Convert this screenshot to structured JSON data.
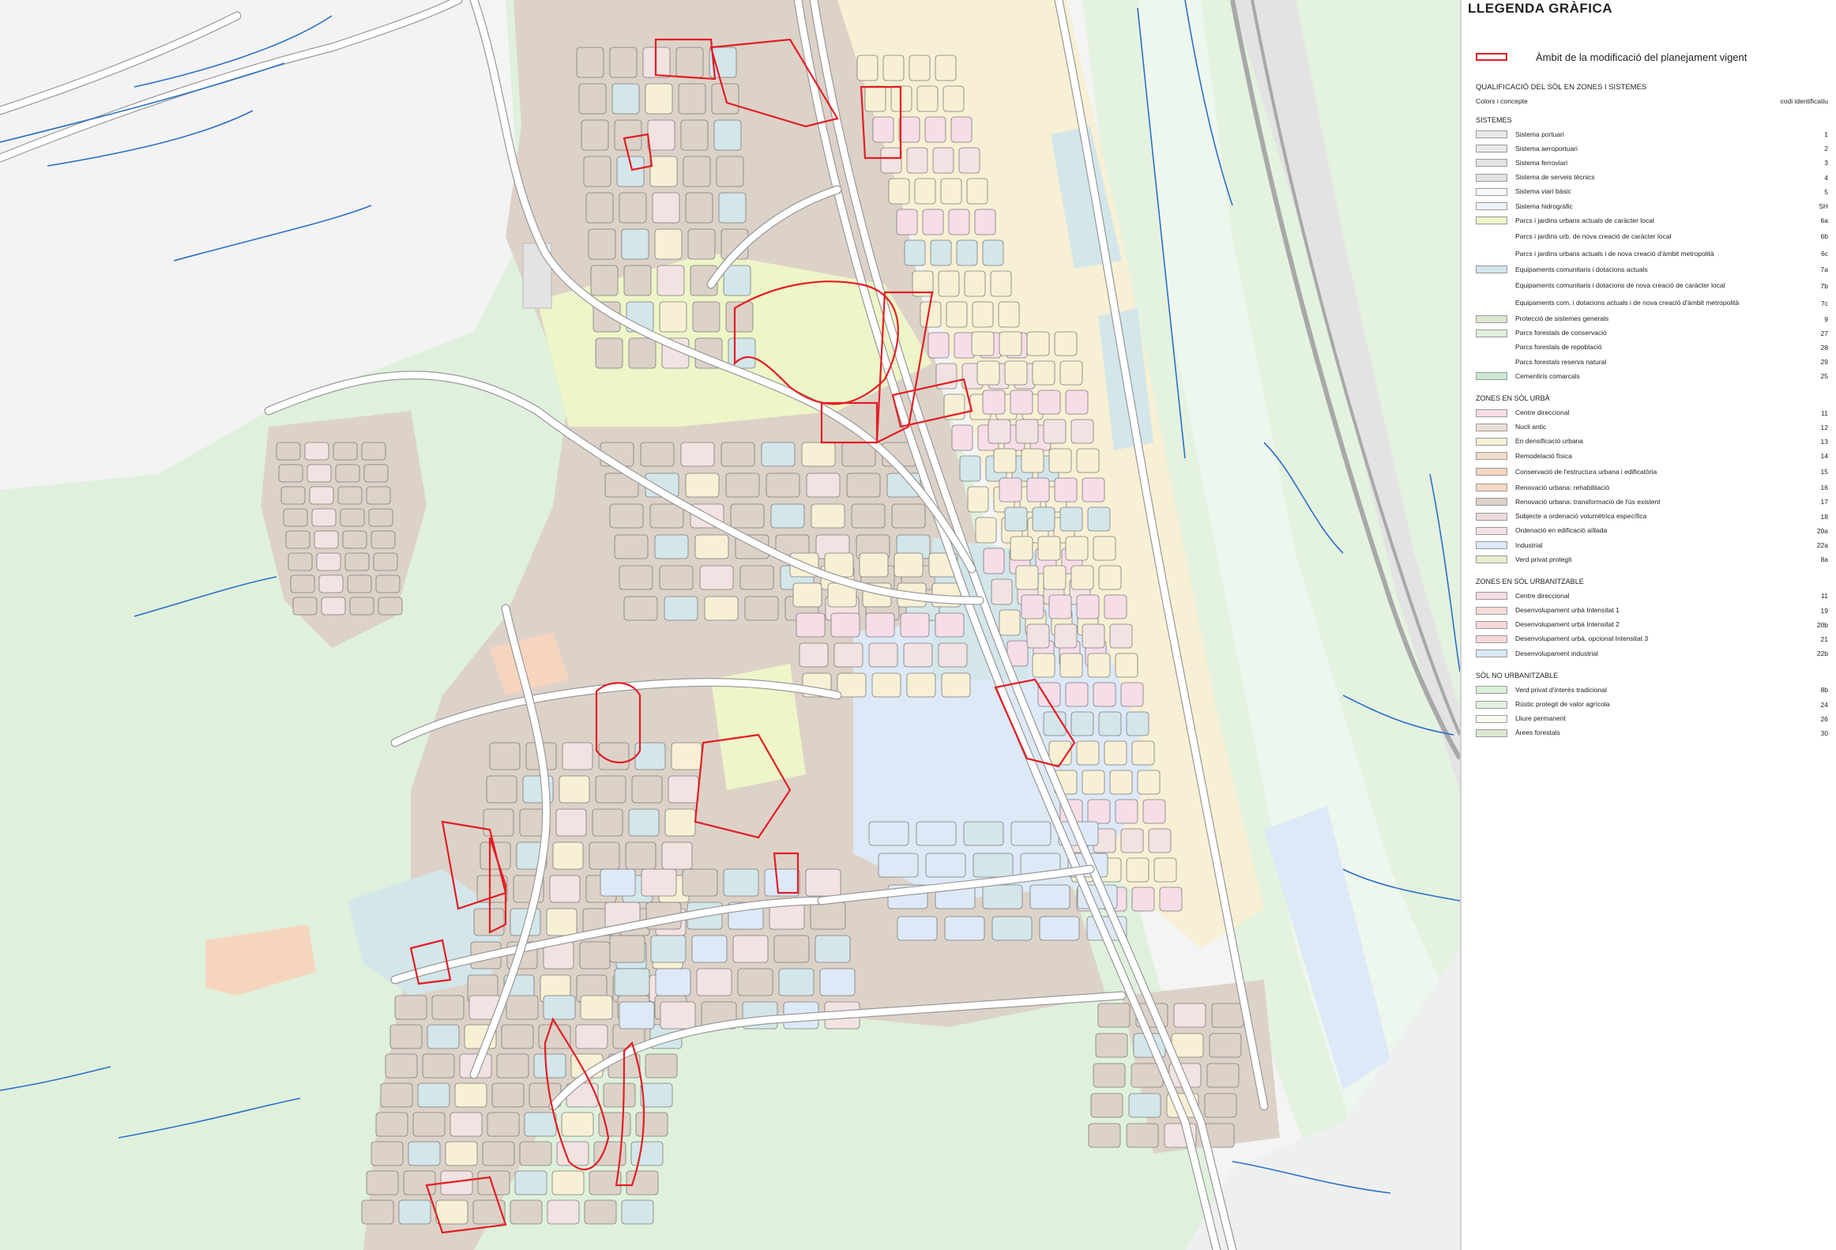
{
  "legend": {
    "title": "LLEGENDA GRÀFICA",
    "ambit": {
      "label": "Àmbit de la modificació del planejament vigent",
      "color": "#e31e24"
    },
    "heading": "QUALIFICACIÓ DEL SÒL EN ZONES I SISTEMES",
    "col_left": "Colors i concepte",
    "col_right": "codi identificatiu",
    "sections": [
      {
        "title": "SISTEMES",
        "items": [
          {
            "label": "Sistema portuari",
            "code": "1",
            "color": "#e9e9e9"
          },
          {
            "label": "Sistema aeroportuari",
            "code": "2",
            "color": "#e9e9e9"
          },
          {
            "label": "Sistema ferroviari",
            "code": "3",
            "color": "#e3e3e3"
          },
          {
            "label": "Sistema de serveis tècnics",
            "code": "4",
            "color": "#e3e3e3"
          },
          {
            "label": "Sistema viari bàsic",
            "code": "5",
            "color": "#f7f7f7"
          },
          {
            "label": "Sistema hidrogràfic",
            "code": "SH",
            "color": "#eef6fb"
          },
          {
            "label": "Parcs i jardins urbans actuals de caràcter local",
            "code": "6a",
            "color": "#eef5c8"
          },
          {
            "label": "Parcs i jardins urb. de nova creació de caràcter local",
            "code": "6b",
            "color": ""
          },
          {
            "label": "Parcs i jardins urbans actuals i de nova creació d'àmbit metropolità",
            "code": "6c",
            "color": ""
          },
          {
            "label": "Equipaments comunitaris i dotacions actuals",
            "code": "7a",
            "color": "#d3e6ea"
          },
          {
            "label": "Equipaments comunitaris i dotacions de nova creació de caràcter local",
            "code": "7b",
            "color": ""
          },
          {
            "label": "Equipaments com. i dotacions actuals i de nova creació d'àmbit metropolità",
            "code": "7c",
            "color": ""
          },
          {
            "label": "Protecció de sistemes generals",
            "code": "9",
            "color": "#dbe6cf"
          },
          {
            "label": "Parcs forestals de conservació",
            "code": "27",
            "color": "#dff1dc"
          },
          {
            "label": "Parcs forestals de repoblació",
            "code": "28",
            "color": ""
          },
          {
            "label": "Parcs forestals reserva natural",
            "code": "29",
            "color": ""
          },
          {
            "label": "Cementiris comarcals",
            "code": "25",
            "color": "#cde6cf"
          }
        ]
      },
      {
        "title": "ZONES EN SÒL URBÀ",
        "items": [
          {
            "label": "Centre direccional",
            "code": "11",
            "color": "#f6dde8"
          },
          {
            "label": "Nucli antic",
            "code": "12",
            "color": "#eadfd7"
          },
          {
            "label": "En densificació urbana",
            "code": "13",
            "color": "#f8f0d4"
          },
          {
            "label": "Remodelació física",
            "code": "14",
            "color": "#f2dccb"
          },
          {
            "label": "Conservació de l'estructura urbana i edificatòria",
            "code": "15",
            "color": "#f6d5bf"
          },
          {
            "label": "Renovació urbana: rehabilitació",
            "code": "16",
            "color": "#f6d8c5"
          },
          {
            "label": "Renovació urbana: transformació de l'ús existent",
            "code": "17",
            "color": "#ddd2c8"
          },
          {
            "label": "Subjecte a ordenació volumètrica específica",
            "code": "18",
            "color": "#ecdcdc"
          },
          {
            "label": "Ordenació en edificació aïllada",
            "code": "20a",
            "color": "#f3e2e2"
          },
          {
            "label": "Industrial",
            "code": "22a",
            "color": "#dde9f6"
          },
          {
            "label": "Verd privat protegit",
            "code": "8a",
            "color": "#e6edcc"
          }
        ]
      },
      {
        "title": "ZONES EN SÒL URBANITZABLE",
        "items": [
          {
            "label": "Centre direccional",
            "code": "11",
            "color": "#f6dce6"
          },
          {
            "label": "Desenvolupament urbà Intensitat 1",
            "code": "19",
            "color": "#f6dada"
          },
          {
            "label": "Desenvolupament urbà Intensitat 2",
            "code": "20b",
            "color": "#f6dada"
          },
          {
            "label": "Desenvolupament urbà, opcional Intensitat 3",
            "code": "21",
            "color": "#f6dada"
          },
          {
            "label": "Desenvolupament industrial",
            "code": "22b",
            "color": "#d8e9f7"
          }
        ]
      },
      {
        "title": "SÒL NO URBANITZABLE",
        "items": [
          {
            "label": "Verd privat d'interès tradicional",
            "code": "8b",
            "color": "#d9efd6"
          },
          {
            "label": "Rústic protegit de valor agrícola",
            "code": "24",
            "color": "#e4f2e0"
          },
          {
            "label": "Lliure permanent",
            "code": "26",
            "color": "#fbfbf1"
          },
          {
            "label": "Àrees forestals",
            "code": "30",
            "color": "#dde8cf"
          }
        ]
      }
    ]
  },
  "map_colors": {
    "forest": "#dff1dc",
    "rural": "#f1f4f1",
    "urban_old": "#ddd2c8",
    "urban_dense": "#f8f0d4",
    "equipment": "#d3e6ea",
    "industrial": "#dde9f6",
    "park": "#eef5c8",
    "isolated": "#f3e2e2",
    "centre": "#f6dde8",
    "agri": "#e4f2e0",
    "rail": "#e3e3e3",
    "road": "#ffffff",
    "water": "#2b6fc9",
    "ambit": "#e31e24",
    "orange": "#f6d5bf"
  }
}
